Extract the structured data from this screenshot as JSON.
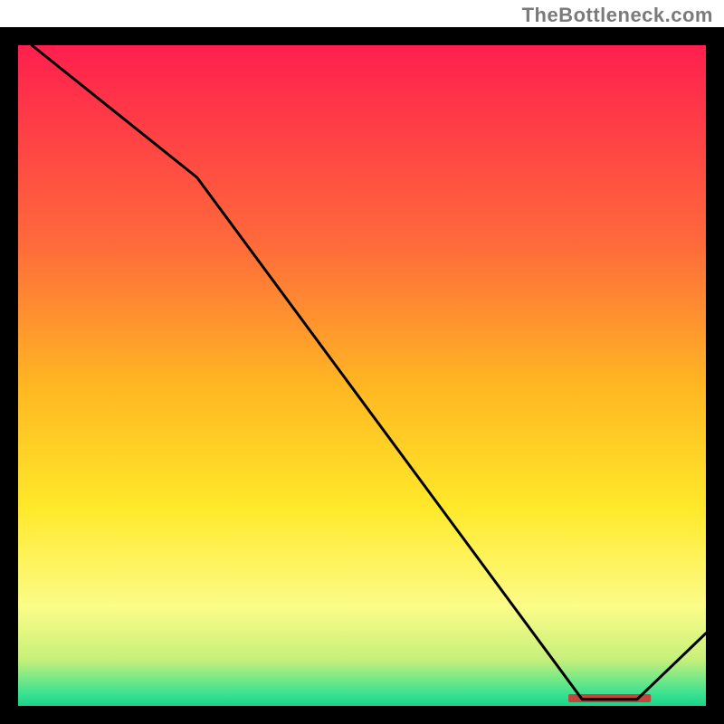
{
  "attribution": "TheBottleneck.com",
  "chart_data": {
    "type": "line",
    "title": "",
    "xlabel": "",
    "ylabel": "",
    "x": [
      0.02,
      0.26,
      0.82,
      0.9,
      1.0
    ],
    "values": [
      1.0,
      0.8,
      0.01,
      0.01,
      0.11
    ],
    "xlim": [
      0,
      1
    ],
    "ylim": [
      0,
      1
    ],
    "background_gradient": {
      "type": "vertical",
      "stops": [
        {
          "offset": 0.0,
          "color": "#ff1f4e"
        },
        {
          "offset": 0.3,
          "color": "#ff6a3b"
        },
        {
          "offset": 0.52,
          "color": "#ffb822"
        },
        {
          "offset": 0.7,
          "color": "#ffe92a"
        },
        {
          "offset": 0.85,
          "color": "#fcfc88"
        },
        {
          "offset": 0.93,
          "color": "#c6f07a"
        },
        {
          "offset": 0.98,
          "color": "#3fe28f"
        },
        {
          "offset": 1.0,
          "color": "#17d48b"
        }
      ]
    },
    "bottom_band": {
      "x_start": 0.8,
      "x_end": 0.92,
      "color": "#c4443e"
    },
    "frame": {
      "thickness_px": 20,
      "color": "#000000"
    }
  }
}
